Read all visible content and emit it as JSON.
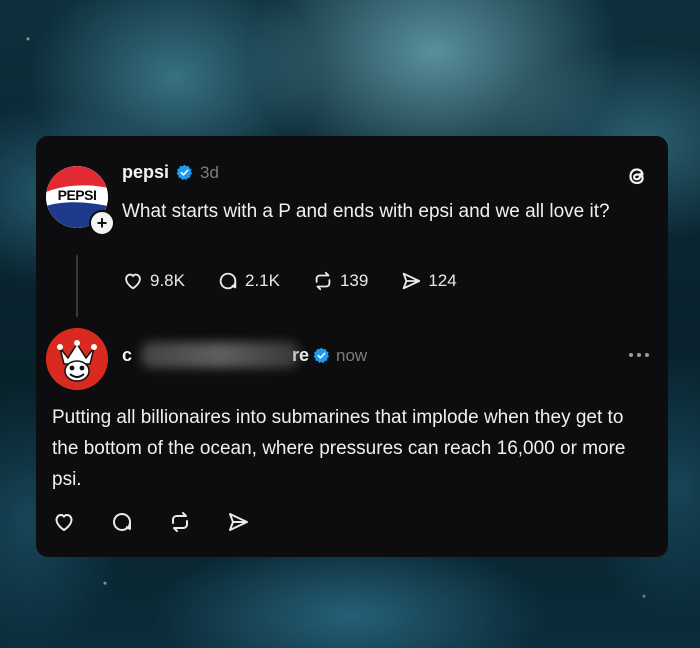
{
  "post": {
    "username": "pepsi",
    "time": "3d",
    "text": "What starts with a P and ends with epsi and we all love it?",
    "avatar_text": "PEPSI",
    "likes": "9.8K",
    "replies": "2.1K",
    "reposts": "139",
    "shares": "124"
  },
  "reply": {
    "username_start": "c",
    "username_end": "re",
    "time": "now",
    "text": "Putting all billionaires into submarines that implode when they get to the bottom of the ocean, where pressures can reach 16,000 or more psi."
  },
  "colors": {
    "verified": "#1d9bf0",
    "pepsi_red": "#e32934",
    "pepsi_blue": "#1e3a8a",
    "card_bg": "#0d0d0f"
  },
  "icons": {
    "threads": "threads-logo-icon",
    "like": "heart-icon",
    "reply": "comment-icon",
    "repost": "repost-icon",
    "share": "send-icon",
    "more": "more-icon",
    "follow": "plus-icon"
  }
}
